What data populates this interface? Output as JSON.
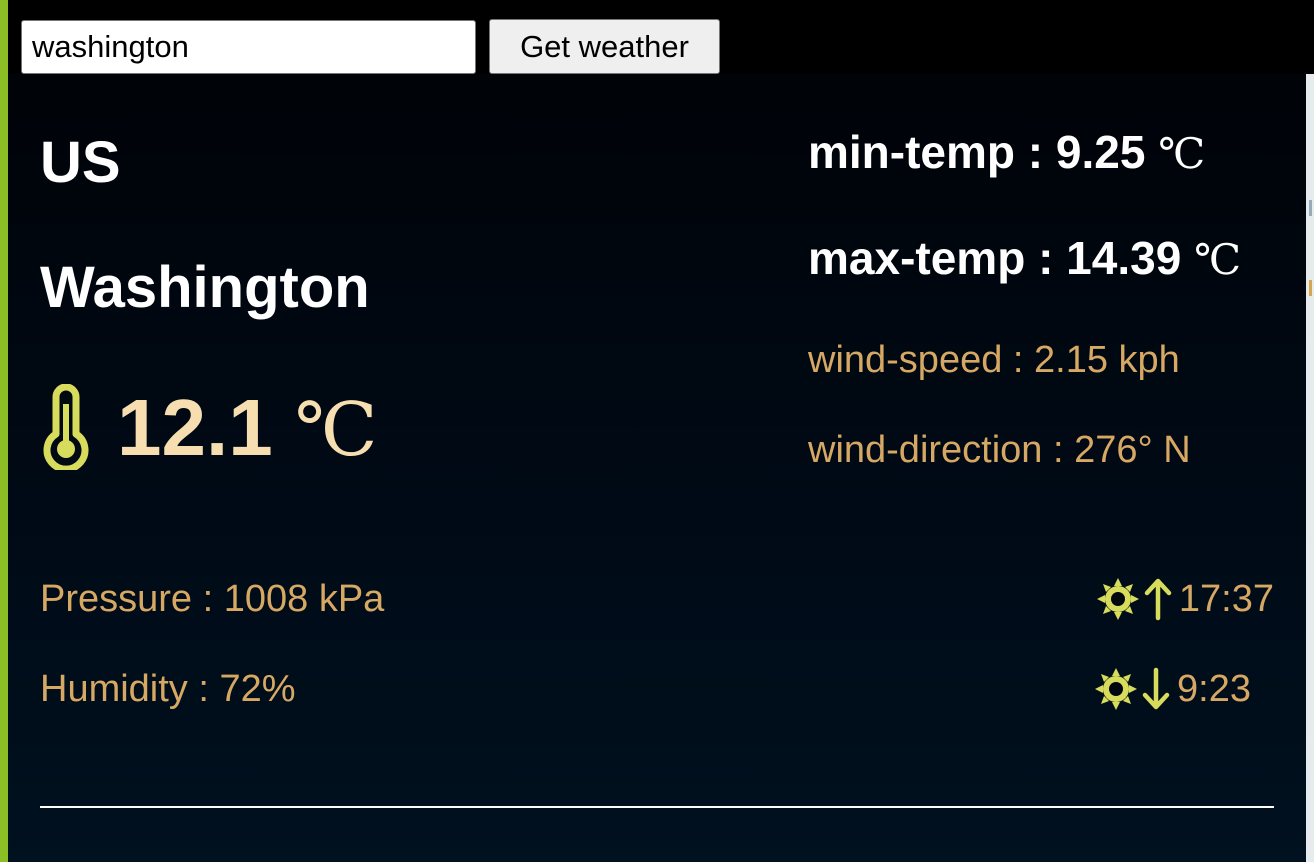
{
  "search": {
    "value": "washington",
    "button_label": "Get weather"
  },
  "location": {
    "country": "US",
    "city": "Washington"
  },
  "current": {
    "temperature": "12.1",
    "unit": "℃"
  },
  "details": {
    "min_temp_label": "min-temp : 9.25",
    "max_temp_label": "max-temp : 14.39",
    "unit": "℃",
    "wind_speed": "wind-speed : 2.15 kph",
    "wind_direction": "wind-direction : 276° N",
    "pressure": "Pressure : 1008 kPa",
    "humidity": "Humidity : 72%",
    "sunrise": "17:37",
    "sunset": "9:23"
  },
  "icons": {
    "thermometer": "thermometer-icon",
    "sunrise": "sun-icon",
    "sunrise_arrow": "arrow-up-icon",
    "sunset": "sun-icon",
    "sunset_arrow": "arrow-down-icon"
  },
  "colors": {
    "accent_green": "#8cbf26",
    "icon_yellow": "#d8dc5c",
    "gold_text": "#d6a864",
    "temp_text": "#f7deb0",
    "panel_bg": "#000a16"
  }
}
